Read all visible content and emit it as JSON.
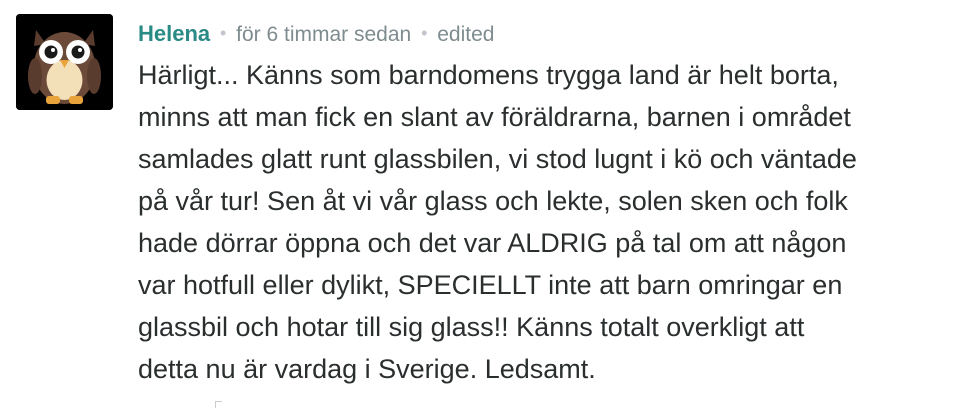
{
  "comment": {
    "author": "Helena",
    "timestamp": "för 6 timmar sedan",
    "edited_label": "edited",
    "separator": "•",
    "lines": [
      "Härligt... Känns som barndomens trygga land är helt borta,",
      "minns att man fick en slant av föräldrarna, barnen i området",
      "samlades glatt runt glassbilen, vi stod lugnt i kö och väntade",
      "på vår tur! Sen åt vi vår glass och lekte, solen sken och folk",
      "hade dörrar öppna och det var ALDRIG på tal om att någon",
      "var hotfull eller dylikt, SPECIELLT inte att barn omringar en",
      "glassbil och hotar till sig glass!! Känns totalt overkligt att",
      "detta nu är vardag i Sverige. Ledsamt."
    ],
    "avatar_icon": "owl-avatar-icon",
    "colors": {
      "author": "#2a8a86",
      "meta": "#7f8c8f",
      "body": "#2a2e2e",
      "avatar_bg": "#000000",
      "owl_body": "#6b4a3a",
      "owl_belly": "#f3e0b8",
      "owl_feet": "#e9a33b"
    }
  }
}
